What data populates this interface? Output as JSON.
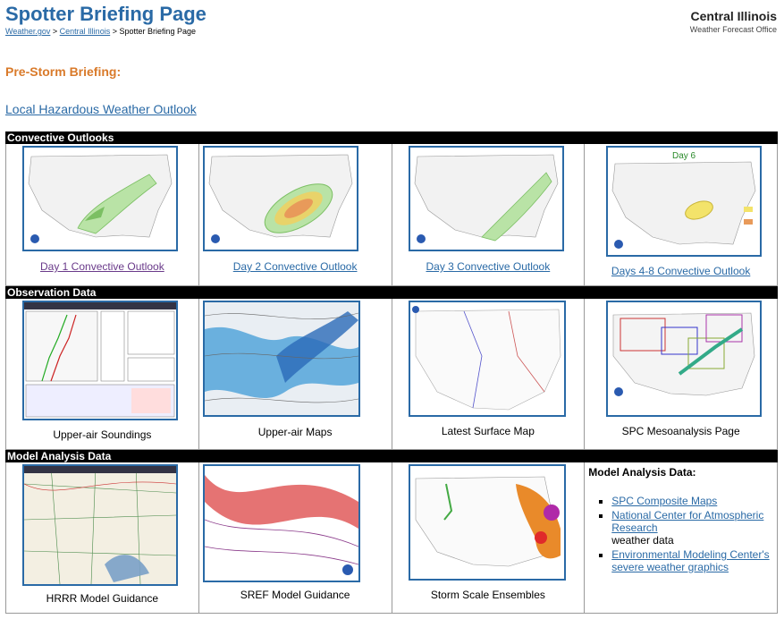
{
  "header": {
    "title": "Spotter Briefing Page",
    "breadcrumb": {
      "home": "Weather.gov",
      "sep1": ">",
      "office": "Central Illinois",
      "sep2": ">",
      "current": "Spotter Briefing Page"
    },
    "office_name": "Central Illinois",
    "office_sub": "Weather Forecast Office"
  },
  "prestorm": "Pre-Storm Briefing:",
  "hwo_link": "Local Hazardous Weather Outlook",
  "sections": {
    "convective": {
      "title": "Convective Outlooks",
      "items": [
        {
          "label": "Day 1 Convective Outlook"
        },
        {
          "label": "Day 2 Convective Outlook"
        },
        {
          "label": "Day 3 Convective Outlook"
        },
        {
          "label": "Days 4-8 Convective Outlook",
          "map_tag": "Day 6"
        }
      ]
    },
    "observation": {
      "title": "Observation Data",
      "items": [
        {
          "label": "Upper-air Soundings"
        },
        {
          "label": "Upper-air Maps"
        },
        {
          "label": "Latest Surface Map"
        },
        {
          "label": "SPC Mesoanalysis Page"
        }
      ]
    },
    "model": {
      "title": "Model Analysis Data",
      "items": [
        {
          "label": "HRRR Model Guidance"
        },
        {
          "label": "SREF Model Guidance"
        },
        {
          "label": "Storm Scale Ensembles"
        }
      ],
      "side": {
        "heading": "Model Analysis Data:",
        "links": [
          {
            "text": "SPC Composite Maps",
            "after": ""
          },
          {
            "text": "National Center for Atmospheric Research",
            "after": "weather data"
          },
          {
            "text": "Environmental Modeling Center's severe weather graphics",
            "after": ""
          }
        ]
      }
    }
  }
}
